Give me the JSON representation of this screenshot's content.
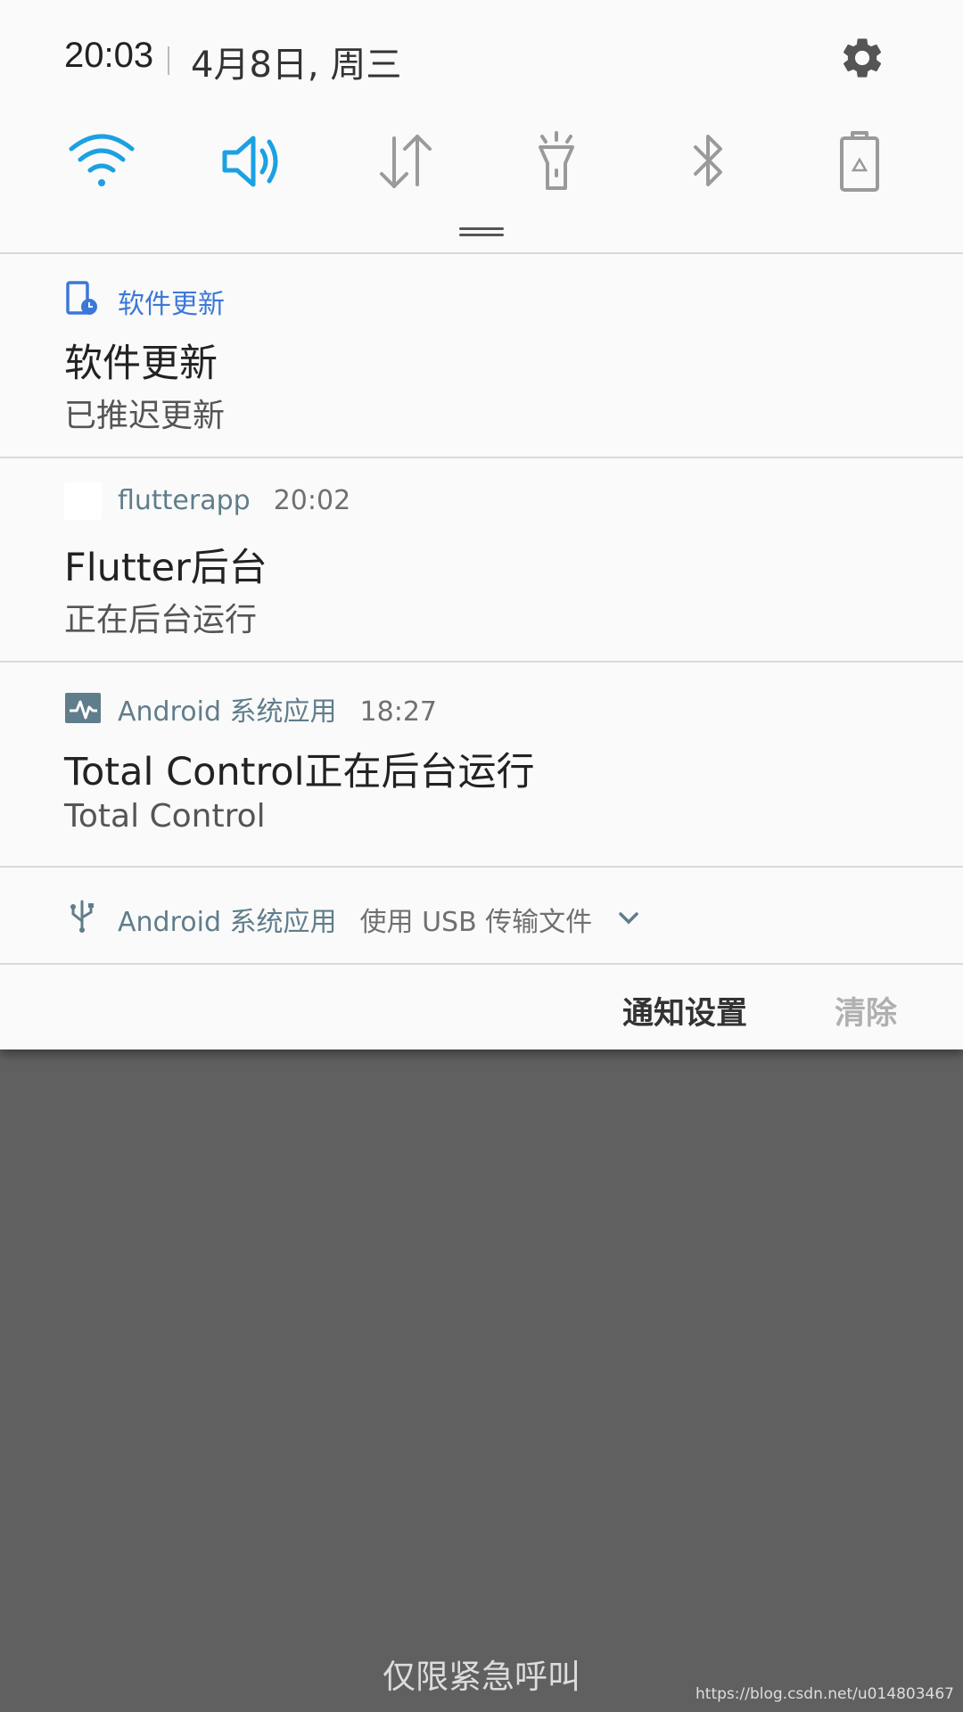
{
  "status": {
    "time": "20:03",
    "date": "4月8日, 周三"
  },
  "quick_settings": [
    {
      "name": "wifi-icon",
      "active": true
    },
    {
      "name": "sound-icon",
      "active": true
    },
    {
      "name": "data-transfer-icon",
      "active": false
    },
    {
      "name": "flashlight-icon",
      "active": false
    },
    {
      "name": "bluetooth-icon",
      "active": false
    },
    {
      "name": "power-saving-icon",
      "active": false
    }
  ],
  "notifications": [
    {
      "app": "软件更新",
      "time": "",
      "title": "软件更新",
      "subtitle": "已推迟更新",
      "icon": "software-update-icon"
    },
    {
      "app": "flutterapp",
      "time": "20:02",
      "title": "Flutter后台",
      "subtitle": "正在后台运行",
      "icon": "flutterapp-icon"
    },
    {
      "app": "Android 系统应用",
      "time": "18:27",
      "title": "Total Control正在后台运行",
      "subtitle": "Total Control",
      "icon": "activity-icon"
    },
    {
      "app": "Android 系统应用",
      "summary": "使用 USB 传输文件",
      "icon": "usb-icon"
    }
  ],
  "footer": {
    "settings_label": "通知设置",
    "clear_label": "清除"
  },
  "lockscreen": {
    "emergency_label": "仅限紧急呼叫"
  },
  "watermark": "https://blog.csdn.net/u014803467",
  "colors": {
    "accent": "#1ba1e2",
    "app_label": "#607d8b",
    "shade_bg": "#fafafa",
    "backdrop": "#606060"
  }
}
